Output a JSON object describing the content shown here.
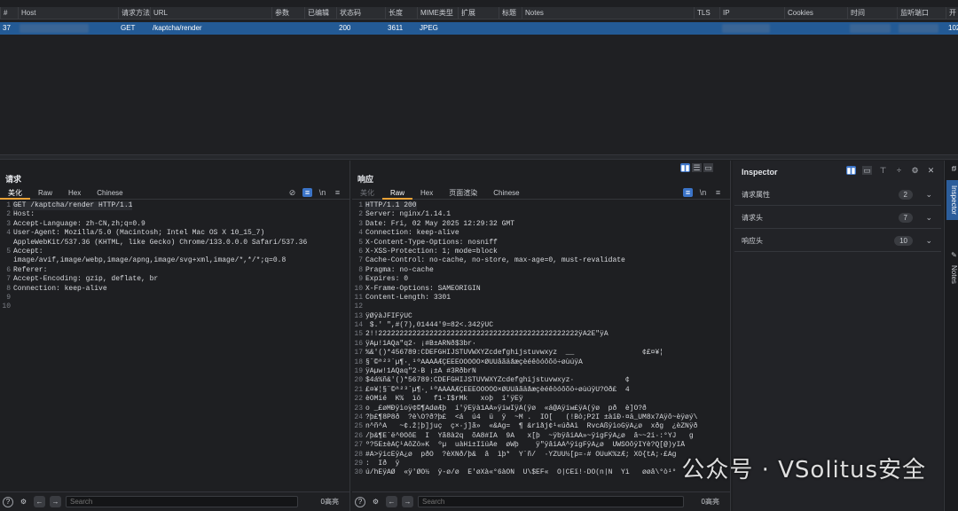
{
  "history": {
    "columns": [
      "#",
      "Host",
      "请求方法",
      "URL",
      "参数",
      "已编辑",
      "状态码",
      "长度",
      "MIME类型",
      "扩展",
      "标题",
      "Notes",
      "TLS",
      "IP",
      "Cookies",
      "时间",
      "监听端口",
      "开"
    ],
    "row": {
      "num": "37",
      "method": "GET",
      "url": "/kaptcha/render",
      "status": "200",
      "length": "3611",
      "mime": "JPEG",
      "port_partial": "102"
    }
  },
  "request": {
    "title": "请求",
    "tabs": [
      "美化",
      "Raw",
      "Hex",
      "Chinese"
    ],
    "lines": [
      "GET /kaptcha/render HTTP/1.1",
      "Host: ",
      "Accept-Language: zh-CN,zh;q=0.9",
      "User-Agent: Mozilla/5.0 (Macintosh; Intel Mac OS X 10_15_7)",
      "AppleWebKit/537.36 (KHTML, like Gecko) Chrome/133.0.0.0 Safari/537.36",
      "Accept:",
      "image/avif,image/webp,image/apng,image/svg+xml,image/*,*/*;q=0.8",
      "Referer: ",
      "Accept-Encoding: gzip, deflate, br",
      "Connection: keep-alive",
      "",
      ""
    ],
    "line_numbers": [
      "1",
      "2",
      "3",
      "4",
      "",
      "5",
      "",
      "6",
      "7",
      "8",
      "9",
      "10"
    ],
    "search_placeholder": "Search",
    "highlight_count": "0高亮"
  },
  "response": {
    "title": "响应",
    "tabs": [
      "美化",
      "Raw",
      "Hex",
      "页面渲染",
      "Chinese"
    ],
    "lines": [
      "HTTP/1.1 200",
      "Server: nginx/1.14.1",
      "Date: Fri, 02 May 2025 12:29:32 GMT",
      "Connection: keep-alive",
      "X-Content-Type-Options: nosniff",
      "X-XSS-Protection: 1; mode=block",
      "Cache-Control: no-cache, no-store, max-age=0, must-revalidate",
      "Pragma: no-cache",
      "Expires: 0",
      "X-Frame-Options: SAMEORIGIN",
      "Content-Length: 3301",
      "",
      "ÿØÿàJFIFÿÛC",
      " $.' \",#(7),01444'9=82<.342ÿÛC",
      "2!!22222222222222222222222222222222222222222222222ÿÀ2È\"ÿÄ",
      "ÿÄµ!1AQa\"q2· ¡#B±ÁRÑð$3br·",
      "%&'()*456789:CDEFGHIJSTUVWXYZcdefghijstuvwxyz  __                ¢£¤¥¦",
      "§¨©ª²³´µ¶·¸¹ºÂÃÄÅÆÇÈÉÊÒÓÔÕÖ×ØÙÚâãäåæçèéêòóôõö÷øùúÿÄ",
      "ÿÄµw!1AQaq\"2·B ¡±Á #3RðbrÑ",
      "$4á%ñ&'()*56789:CDEFGHIJSTUVWXYZcdefghijstuvwxyz·            ¢",
      "£¤¥¦§¨©ª²³´µ¶·¸¹ºÂÃÄÅÆÇÈÉÊÒÓÔÕÖ×ØÙÚâãäåæçèéêòóôõö÷øùúÿÚ?Öð£  4",
      "èÖMié  K%  ìö   f1-I$rMk   xoþ  í'ÿÉÿ",
      "o _£øMÐÿìoÿ¢©¶ÂdøÆþ  í'ÿÉÿà1ÂÁ»ÿiwIÿÃ(ÿø  «á@Âÿiw£ÿÃ(ÿø  pð  è]Ö?ð",
      "?þ£¶8P8ð  ?è\\Ö?ð?þ£  <á  ú4  ü  ÿ  ~M .  ÎÕ[   (!Bò;P2I ±àïÐ·¤ä_ÜM8x7Äÿô~èÿøý\\",
      "n^ñ^Á   ~¢.ž¦þ]juç  ç×·j]ã»  «&Äg=  ¶¯&rìåj¢¹«úðÀì  RvcÁßÿìoGÿÁ¿ø  xðg  ¿èZÑÿð",
      "/þ&¶E`ë^0ÕôE  Î  Ýã8à2q  õÀ8#ÌA  9Â   x[þ  ~ÿbÿâiÂÁ»~ÿigFÿÁ¿ø  â~~2i·:°YJ   g",
      "º?5É±èÁÇ¹ÁôZö»K  ºµ  uàHi±ÏïúÅe  øWþ    ÿ\"ÿâiÂÁ^ÿigFÿÁ¿ø  ÜWSÕôÿÎYè?Q[@)yIÅ",
      "#Â>ÿicEÿÁ¿ø  pðO  ?èXÑð/þ&  â  ìþ*  Y´ñ/  ·YZÜÜ½[p=·#¯ÖÜuK%zÆ; XÖ{tÃ;·£Ag",
      ":  Îð  ÿ",
      "ú/hEÿÁØ  «ÿ'ØO½  ÿ-ø/ø  Ê'øXà«°6àÒÑ  Ù\\$ÉF«  Ò|CÉï!·DÕ(n|Ñ  Ýì   øøâ\\°ò¹°"
    ],
    "search_placeholder": "Search",
    "highlight_count": "0高亮"
  },
  "inspector": {
    "title": "Inspector",
    "sections": [
      {
        "label": "请求属性",
        "count": "2"
      },
      {
        "label": "请求头",
        "count": "7"
      },
      {
        "label": "响应头",
        "count": "10"
      }
    ]
  },
  "sidebar": {
    "tabs": [
      "Inspector",
      "Notes"
    ]
  },
  "watermark": "公众号 · VSolitus安全"
}
